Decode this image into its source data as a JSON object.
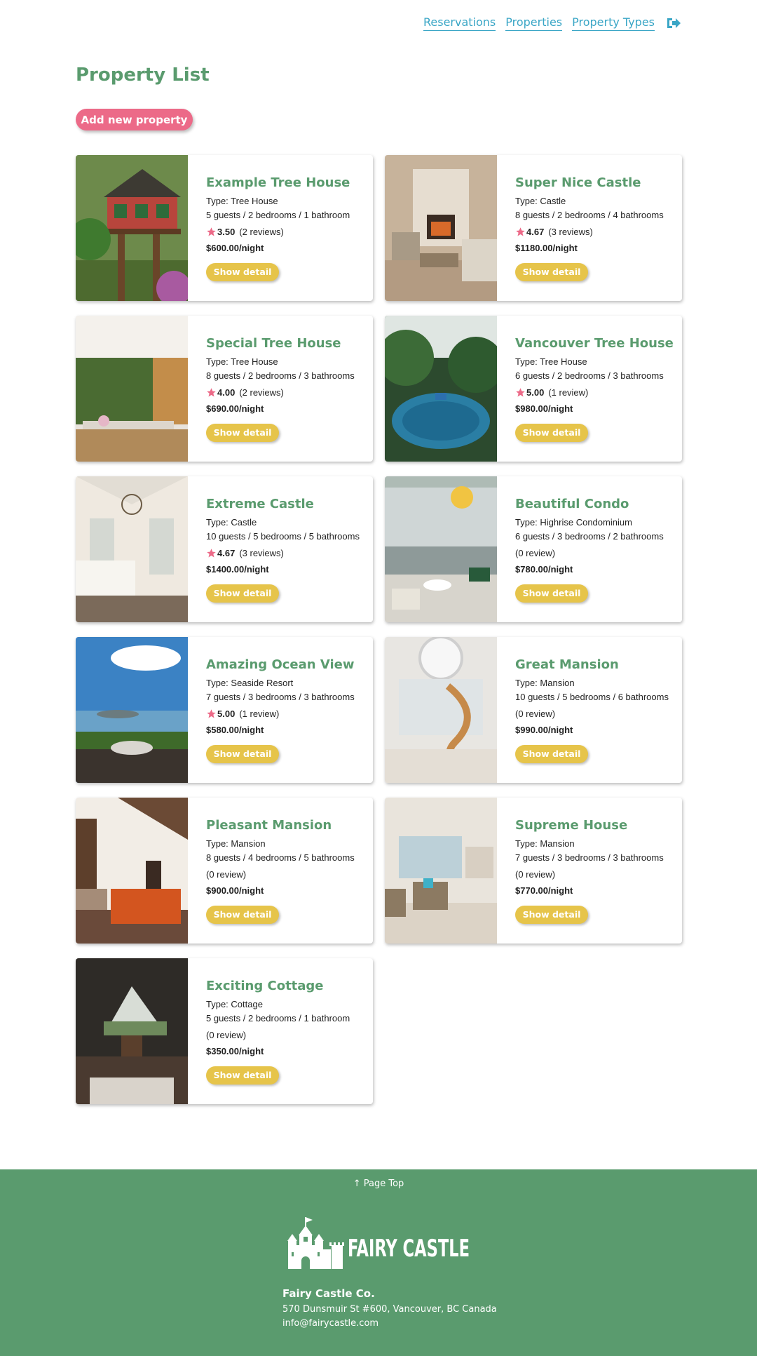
{
  "nav": {
    "links": [
      "Reservations",
      "Properties",
      "Property Types"
    ],
    "logout_icon": "logout-icon"
  },
  "page": {
    "title": "Property List",
    "add_button": "Add new property"
  },
  "properties": [
    {
      "name": "Example Tree House",
      "type": "Type: Tree House",
      "capacity": "5 guests / 2 bedrooms / 1 bathroom",
      "rating": "3.50",
      "reviews": "(2 reviews)",
      "price": "$600.00/night",
      "button": "Show detail",
      "photo": "treehouse"
    },
    {
      "name": "Super Nice Castle",
      "type": "Type: Castle",
      "capacity": "8 guests / 2 bedrooms / 4 bathrooms",
      "rating": "4.67",
      "reviews": "(3 reviews)",
      "price": "$1180.00/night",
      "button": "Show detail",
      "photo": "living-fireplace"
    },
    {
      "name": "Special Tree House",
      "type": "Type: Tree House",
      "capacity": "8 guests / 2 bedrooms / 3 bathrooms",
      "rating": "4.00",
      "reviews": "(2 reviews)",
      "price": "$690.00/night",
      "button": "Show detail",
      "photo": "dining-garden"
    },
    {
      "name": "Vancouver Tree House",
      "type": "Type: Tree House",
      "capacity": "6 guests / 2 bedrooms / 3 bathrooms",
      "rating": "5.00",
      "reviews": "(1 review)",
      "price": "$980.00/night",
      "button": "Show detail",
      "photo": "pool-jungle"
    },
    {
      "name": "Extreme Castle",
      "type": "Type: Castle",
      "capacity": "10 guests / 5 bedrooms / 5 bathrooms",
      "rating": "4.67",
      "reviews": "(3 reviews)",
      "price": "$1400.00/night",
      "button": "Show detail",
      "photo": "bedroom-chandelier"
    },
    {
      "name": "Beautiful Condo",
      "type": "Type: Highrise Condominium",
      "capacity": "6 guests / 3 bedrooms / 2 bathrooms",
      "rating": "",
      "reviews": "(0 review)",
      "price": "$780.00/night",
      "button": "Show detail",
      "photo": "condo-view"
    },
    {
      "name": "Amazing Ocean View",
      "type": "Type: Seaside Resort",
      "capacity": "7 guests / 3 bedrooms / 3 bathrooms",
      "rating": "5.00",
      "reviews": "(1 review)",
      "price": "$580.00/night",
      "button": "Show detail",
      "photo": "ocean-terrace"
    },
    {
      "name": "Great Mansion",
      "type": "Type: Mansion",
      "capacity": "10 guests / 5 bedrooms / 6 bathrooms",
      "rating": "",
      "reviews": "(0 review)",
      "price": "$990.00/night",
      "button": "Show detail",
      "photo": "spiral-stairs"
    },
    {
      "name": "Pleasant Mansion",
      "type": "Type: Mansion",
      "capacity": "8 guests / 4 bedrooms / 5 bathrooms",
      "rating": "",
      "reviews": "(0 review)",
      "price": "$900.00/night",
      "button": "Show detail",
      "photo": "orange-sofa"
    },
    {
      "name": "Supreme House",
      "type": "Type: Mansion",
      "capacity": "7 guests / 3 bedrooms / 3 bathrooms",
      "rating": "",
      "reviews": "(0 review)",
      "price": "$770.00/night",
      "button": "Show detail",
      "photo": "bright-living"
    },
    {
      "name": "Exciting Cottage",
      "type": "Type: Cottage",
      "capacity": "5 guests / 2 bedrooms / 1 bathroom",
      "rating": "",
      "reviews": "(0 review)",
      "price": "$350.00/night",
      "button": "Show detail",
      "photo": "cottage-bedroom"
    }
  ],
  "footer": {
    "page_top": "Page Top",
    "logo_text": "FAIRY CASTLE",
    "company": "Fairy Castle Co.",
    "address": "570 Dunsmuir St #600, Vancouver, BC Canada",
    "email": "info@fairycastle.com"
  },
  "colors": {
    "accent_green": "#5a9b6e",
    "link_blue": "#3aa6c6",
    "add_pink": "#ec6a88",
    "detail_yellow": "#e6c44a",
    "star_pink": "#ec6a88"
  }
}
